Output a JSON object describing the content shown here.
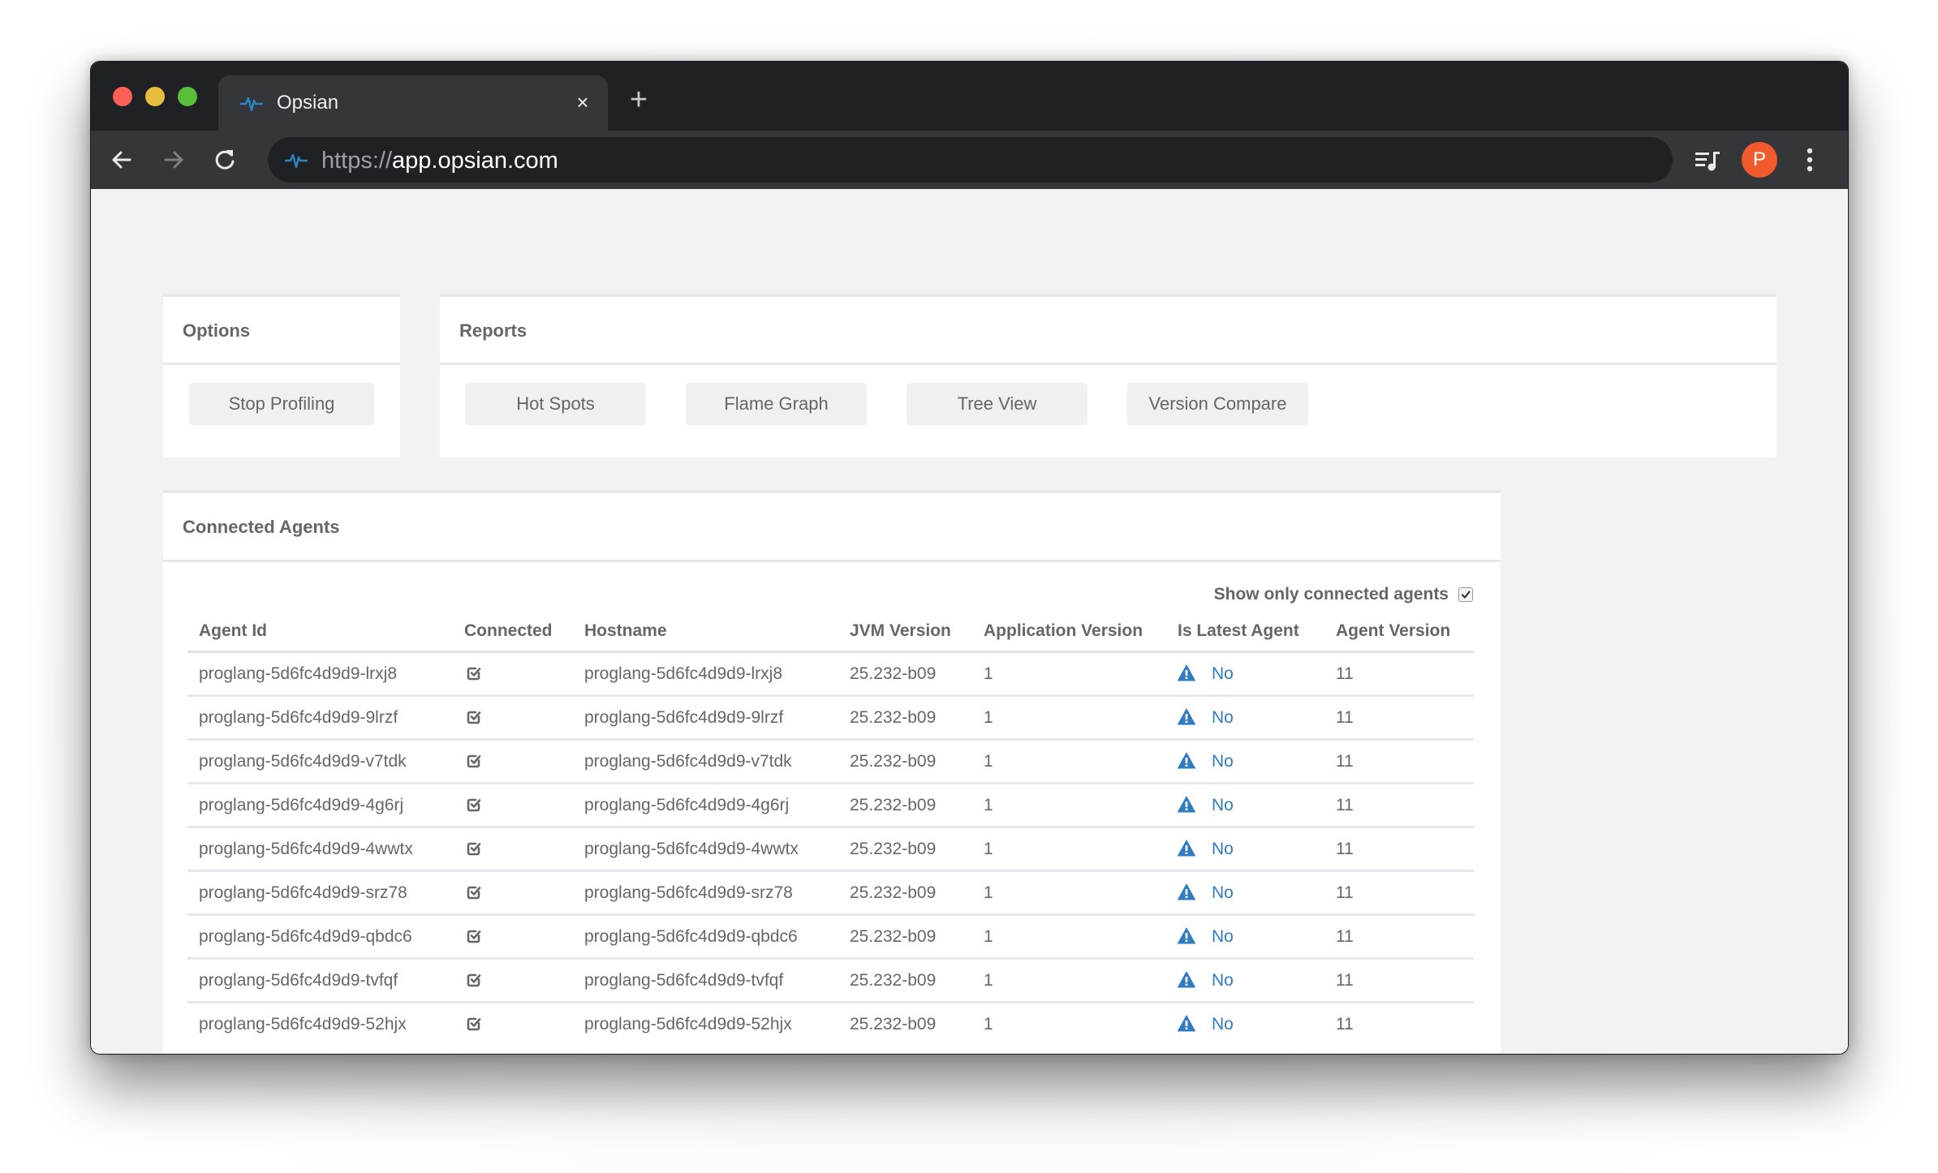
{
  "browser": {
    "tab_title": "Opsian",
    "tab_close": "×",
    "new_tab": "+",
    "url_scheme": "https://",
    "url_host": "app.opsian.com",
    "avatar_letter": "P",
    "accent_color": "#2f7cc0",
    "avatar_color": "#f15a2c"
  },
  "options": {
    "title": "Options",
    "buttons": [
      {
        "label": "Stop Profiling"
      }
    ]
  },
  "reports": {
    "title": "Reports",
    "buttons": [
      {
        "label": "Hot Spots"
      },
      {
        "label": "Flame Graph"
      },
      {
        "label": "Tree View"
      },
      {
        "label": "Version Compare"
      }
    ]
  },
  "agents": {
    "title": "Connected Agents",
    "filter_label": "Show only connected agents",
    "filter_checked": true,
    "columns": [
      "Agent Id",
      "Connected",
      "Hostname",
      "JVM Version",
      "Application Version",
      "Is Latest Agent",
      "Agent Version"
    ],
    "rows": [
      {
        "agent_id": "proglang-5d6fc4d9d9-lrxj8",
        "connected": true,
        "hostname": "proglang-5d6fc4d9d9-lrxj8",
        "jvm_version": "25.232-b09",
        "app_version": "1",
        "is_latest": "No",
        "agent_version": "11"
      },
      {
        "agent_id": "proglang-5d6fc4d9d9-9lrzf",
        "connected": true,
        "hostname": "proglang-5d6fc4d9d9-9lrzf",
        "jvm_version": "25.232-b09",
        "app_version": "1",
        "is_latest": "No",
        "agent_version": "11"
      },
      {
        "agent_id": "proglang-5d6fc4d9d9-v7tdk",
        "connected": true,
        "hostname": "proglang-5d6fc4d9d9-v7tdk",
        "jvm_version": "25.232-b09",
        "app_version": "1",
        "is_latest": "No",
        "agent_version": "11"
      },
      {
        "agent_id": "proglang-5d6fc4d9d9-4g6rj",
        "connected": true,
        "hostname": "proglang-5d6fc4d9d9-4g6rj",
        "jvm_version": "25.232-b09",
        "app_version": "1",
        "is_latest": "No",
        "agent_version": "11"
      },
      {
        "agent_id": "proglang-5d6fc4d9d9-4wwtx",
        "connected": true,
        "hostname": "proglang-5d6fc4d9d9-4wwtx",
        "jvm_version": "25.232-b09",
        "app_version": "1",
        "is_latest": "No",
        "agent_version": "11"
      },
      {
        "agent_id": "proglang-5d6fc4d9d9-srz78",
        "connected": true,
        "hostname": "proglang-5d6fc4d9d9-srz78",
        "jvm_version": "25.232-b09",
        "app_version": "1",
        "is_latest": "No",
        "agent_version": "11"
      },
      {
        "agent_id": "proglang-5d6fc4d9d9-qbdc6",
        "connected": true,
        "hostname": "proglang-5d6fc4d9d9-qbdc6",
        "jvm_version": "25.232-b09",
        "app_version": "1",
        "is_latest": "No",
        "agent_version": "11"
      },
      {
        "agent_id": "proglang-5d6fc4d9d9-tvfqf",
        "connected": true,
        "hostname": "proglang-5d6fc4d9d9-tvfqf",
        "jvm_version": "25.232-b09",
        "app_version": "1",
        "is_latest": "No",
        "agent_version": "11"
      },
      {
        "agent_id": "proglang-5d6fc4d9d9-52hjx",
        "connected": true,
        "hostname": "proglang-5d6fc4d9d9-52hjx",
        "jvm_version": "25.232-b09",
        "app_version": "1",
        "is_latest": "No",
        "agent_version": "11"
      }
    ]
  }
}
